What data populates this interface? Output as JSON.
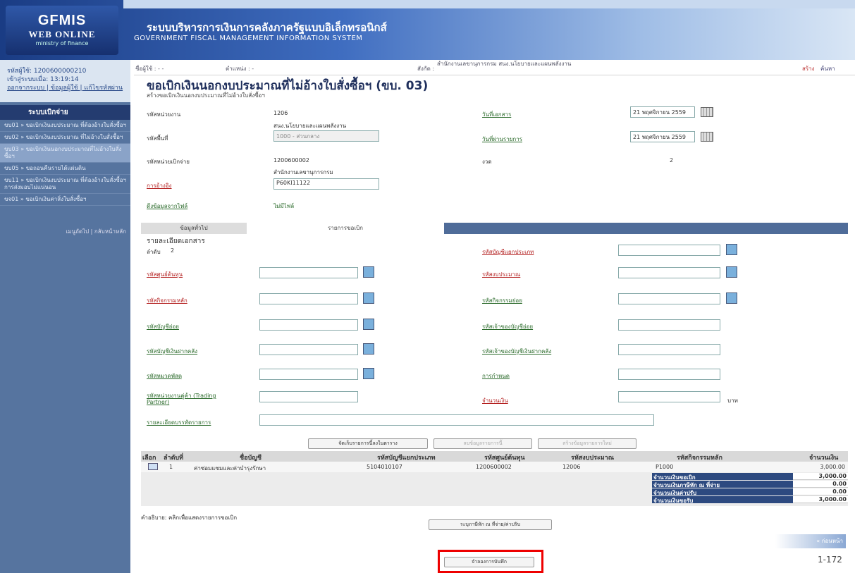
{
  "header": {
    "logo_line1": "GFMIS",
    "logo_line2": "WEB ONLINE",
    "logo_line3": "ministry of finance",
    "title_th": "ระบบบริหารการเงินการคลังภาครัฐแบบอิเล็กทรอนิกส์",
    "title_en": "GOVERNMENT FISCAL MANAGEMENT INFORMATION SYSTEM"
  },
  "sidebar": {
    "user_code": "รหัสผู้ใช้: 1200600000210",
    "login_time": "เข้าสู่ระบบเมื่อ: 13:19:14",
    "links": "ออกจากระบบ | ข้อมูลผู้ใช้ | แก้ไขรหัสผ่าน",
    "menu_title": "ระบบเบิกจ่าย",
    "items": [
      {
        "label": "ขบ01 » ขอเบิกเงินงบประมาณ ที่ต้องอ้างใบสั่งซื้อฯ"
      },
      {
        "label": "ขบ02 » ขอเบิกเงินงบประมาณ ที่ไม่อ้างใบสั่งซื้อฯ"
      },
      {
        "label": "ขบ03 » ขอเบิกเงินนอกงบประมาณที่ไม่อ้างใบสั่งซื้อฯ"
      },
      {
        "label": "ขบ05 » ขอถอนคืนรายได้แผ่นดิน"
      },
      {
        "label": "ขบ11 » ขอเบิกเงินงบประมาณ ที่ต้องอ้างใบสั่งซื้อฯ การส่งมอบไม่แน่นอน"
      },
      {
        "label": "ขจ01 » ขอเบิกเงินค่าสิ่งใบสั่งซื้อฯ"
      }
    ],
    "footer": "เมนูถัดไป | กลับหน้าหลัก"
  },
  "topbar": {
    "user": "ชื่อผู้ใช้ : - -",
    "position": "ตำแหน่ง :       -",
    "affil_label": "สังกัด :",
    "affil": "สำนักงานเลขานุการกรม สนง.นโยบายและแผนพลังงาน",
    "create": "สร้าง",
    "search": "ค้นหา"
  },
  "page": {
    "title": "ขอเบิกเงินนอกงบประมาณที่ไม่อ้างใบสั่งซื้อฯ (ขบ. 03)",
    "subtitle": "สร้างขอเบิกเงินนอกงบประมาณที่ไม่อ้างใบสั่งซื้อฯ"
  },
  "form": {
    "agency_label": "รหัสหน่วยงาน",
    "agency_code": "1206",
    "agency_name": "สนง.นโยบายและแผนพลังงาน",
    "area_label": "รหัสพื้นที่",
    "area_value": "1000 - ส่วนกลาง",
    "unit_label": "รหัสหน่วยเบิกจ่าย",
    "unit_code": "1200600002",
    "unit_name": "สำนักงานเลขานุการกรม",
    "ref_label": "การอ้างอิง",
    "ref_value": "P60KI11122",
    "file_label": "ดึงข้อมูลจากไฟล์",
    "file_value": "ไม่มีไฟล์",
    "docdate_label": "วันที่เอกสาร",
    "docdate_value": "21 พฤศจิกายน 2559",
    "postdate_label": "วันที่ผ่านรายการ",
    "postdate_value": "21 พฤศจิกายน 2559",
    "period_label": "งวด",
    "period_value": "2"
  },
  "tabs": [
    "ข้อมูลทั่วไป",
    "รายการขอเบิก"
  ],
  "detail": {
    "heading": "รายละเอียดเอกสาร",
    "seq_label": "ลำดับ",
    "seq_value": "2",
    "left_fields": [
      "รหัสศูนย์ต้นทุน",
      "รหัสกิจกรรมหลัก",
      "รหัสบัญชีย่อย",
      "รหัสบัญชีเงินฝากคลัง",
      "รหัสหมวดพัสดุ",
      "รหัสหน่วยงานคู่ค้า (Trading Partner)"
    ],
    "right_fields": [
      "รหัสบัญชีแยกประเภท",
      "รหัสงบประมาณ",
      "รหัสกิจกรรมย่อย",
      "รหัสเจ้าของบัญชีย่อย",
      "รหัสเจ้าของบัญชีเงินฝากคลัง",
      "การกำหนด",
      "จำนวนเงิน"
    ],
    "amount_unit": "บาท",
    "desc_label": "รายละเอียดบรรทัดรายการ"
  },
  "buttons": {
    "save_item": "จัดเก็บรายการนี้ลงในตาราง",
    "edit_item": "ลบข้อมูลรายการนี้",
    "new_item": "สร้างข้อมูลรายการใหม่",
    "deduct": "ระบุภาษีหัก ณ ที่จ่าย/ค่าปรับ",
    "simulate": "จำลองการบันทึก",
    "next_page": "« ก่อนหน้า"
  },
  "table": {
    "headers": [
      "เลือก",
      "ลำดับที่",
      "ชื่อบัญชี",
      "รหัสบัญชีแยกประเภท",
      "รหัสศูนย์ต้นทุน",
      "รหัสงบประมาณ",
      "รหัสกิจกรรมหลัก",
      "จำนวนเงิน"
    ],
    "rows": [
      {
        "seq": "1",
        "account": "ค่าซ่อมแซมและค่าบำรุงรักษา",
        "gl": "5104010107",
        "cost": "1200600002",
        "budget": "12006",
        "activity": "P1000",
        "amount": "3,000.00"
      }
    ],
    "summary": [
      {
        "label": "จำนวนเงินขอเบิก",
        "value": "3,000.00"
      },
      {
        "label": "จำนวนเงินภาษีหัก ณ ที่จ่าย",
        "value": "0.00"
      },
      {
        "label": "จำนวนเงินค่าปรับ",
        "value": "0.00"
      },
      {
        "label": "จำนวนเงินขอรับ",
        "value": "3,000.00"
      }
    ]
  },
  "footnote": "คำอธิบาย:  คลิกเพื่อแสดงรายการขอเบิก",
  "page_number": "1-172"
}
